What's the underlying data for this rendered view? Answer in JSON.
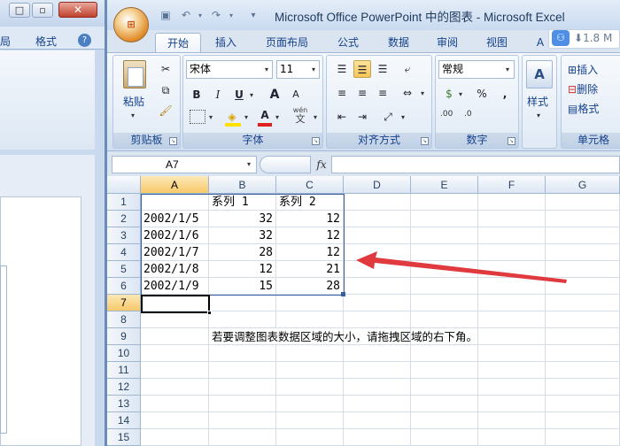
{
  "ppt": {
    "tabs": [
      "局",
      "格式"
    ],
    "help": "?"
  },
  "excel": {
    "title": "Microsoft Office PowerPoint 中的图表 - Microsoft Excel",
    "tabs": [
      "开始",
      "插入",
      "页面布局",
      "公式",
      "数据",
      "审阅",
      "视图",
      "A"
    ],
    "badge": "1.8 M",
    "clipboard": {
      "paste": "粘贴",
      "label": "剪贴板"
    },
    "font": {
      "name": "宋体",
      "size": "11",
      "label": "字体",
      "bold": "B",
      "italic": "I",
      "underline": "U",
      "grow": "A",
      "shrink": "A",
      "wen": "wén",
      "wen_char": "文"
    },
    "alignment": {
      "label": "对齐方式"
    },
    "number": {
      "format": "常规",
      "pct": "%",
      "comma": ",",
      "label": "数字",
      "inc": ".00",
      "dec": ".0"
    },
    "styles": {
      "label": "样式"
    },
    "cells": {
      "insert": "插入",
      "delete": "删除",
      "format": "格式",
      "label": "单元格"
    },
    "namebox": "A7",
    "fx": "fx"
  },
  "sheet": {
    "columns": [
      "A",
      "B",
      "C",
      "D",
      "E",
      "F",
      "G"
    ],
    "rows": [
      "1",
      "2",
      "3",
      "4",
      "5",
      "6",
      "7",
      "8",
      "9",
      "10",
      "11",
      "12",
      "13",
      "14",
      "15"
    ],
    "cells": {
      "B1": "系列 1",
      "C1": "系列 2",
      "A2": "2002/1/5",
      "B2": "32",
      "C2": "12",
      "A3": "2002/1/6",
      "B3": "32",
      "C3": "12",
      "A4": "2002/1/7",
      "B4": "28",
      "C4": "12",
      "A5": "2002/1/8",
      "B5": "12",
      "C5": "21",
      "A6": "2002/1/9",
      "B6": "15",
      "C6": "28",
      "B9": "若要调整图表数据区域的大小，请拖拽区域的右下角。"
    }
  },
  "colors": {
    "arrow": "#e0393e",
    "selection": "#000000",
    "range_border": "#3a5fa0"
  }
}
